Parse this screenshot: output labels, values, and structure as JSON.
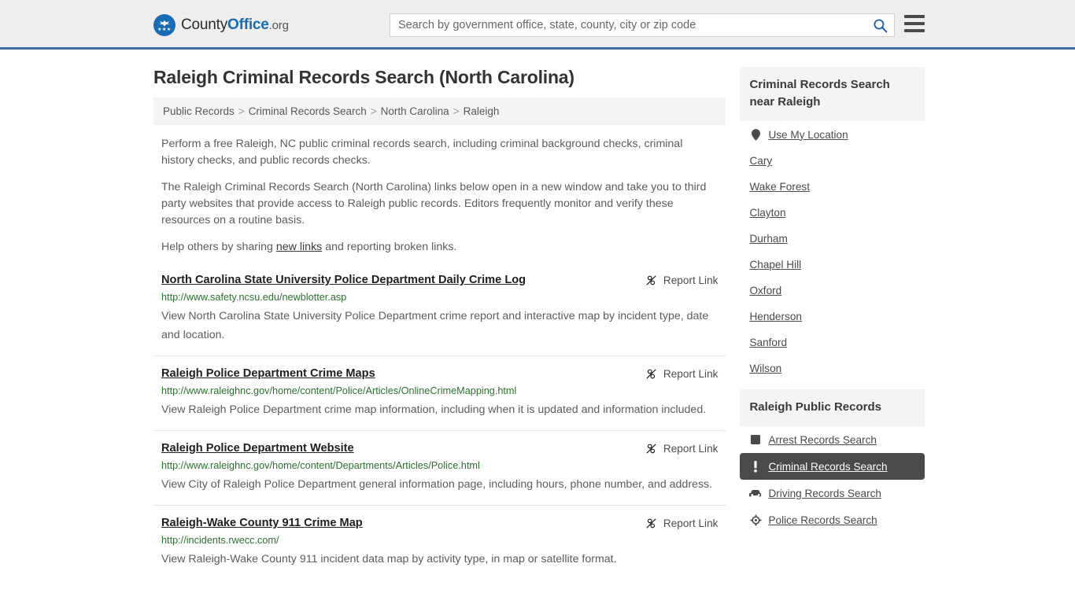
{
  "header": {
    "logo": {
      "name_part1": "County",
      "name_part2": "Office",
      "tld": ".org"
    },
    "search": {
      "placeholder": "Search by government office, state, county, city or zip code",
      "value": ""
    },
    "search_icon": "search-icon",
    "menu_icon": "hamburger-menu-icon",
    "accent_color": "#3a6ea5"
  },
  "main": {
    "title": "Raleigh Criminal Records Search (North Carolina)",
    "breadcrumb": [
      "Public Records",
      "Criminal Records Search",
      "North Carolina",
      "Raleigh"
    ],
    "breadcrumb_separator": ">",
    "intro": {
      "paragraph1": "Perform a free Raleigh, NC public criminal records search, including criminal background checks, criminal history checks, and public records checks.",
      "paragraph2": "The Raleigh Criminal Records Search (North Carolina) links below open in a new window and take you to third party websites that provide access to Raleigh public records. Editors frequently monitor and verify these resources on a routine basis.",
      "paragraph3_before": "Help others by sharing ",
      "paragraph3_link": "new links",
      "paragraph3_after": " and reporting broken links."
    },
    "report_link_label": "Report Link",
    "report_link_icon": "broken-link-icon",
    "results": [
      {
        "title": "North Carolina State University Police Department Daily Crime Log",
        "url": "http://www.safety.ncsu.edu/newblotter.asp",
        "description": "View North Carolina State University Police Department crime report and interactive map by incident type, date and location."
      },
      {
        "title": "Raleigh Police Department Crime Maps",
        "url": "http://www.raleighnc.gov/home/content/Police/Articles/OnlineCrimeMapping.html",
        "description": "View Raleigh Police Department crime map information, including when it is updated and information included."
      },
      {
        "title": "Raleigh Police Department Website",
        "url": "http://www.raleighnc.gov/home/content/Departments/Articles/Police.html",
        "description": "View City of Raleigh Police Department general information page, including hours, phone number, and address."
      },
      {
        "title": "Raleigh-Wake County 911 Crime Map",
        "url": "http://incidents.rwecc.com/",
        "description": "View Raleigh-Wake County 911 incident data map by activity type, in map or satellite format."
      }
    ]
  },
  "sidebar": {
    "nearby": {
      "heading": "Criminal Records Search near Raleigh",
      "use_my_location": {
        "label": "Use My Location",
        "icon": "map-pin-icon"
      },
      "cities": [
        "Cary",
        "Wake Forest",
        "Clayton",
        "Durham",
        "Chapel Hill",
        "Oxford",
        "Henderson",
        "Sanford",
        "Wilson"
      ]
    },
    "public_records": {
      "heading": "Raleigh Public Records",
      "items": [
        {
          "label": "Arrest Records Search",
          "icon": "handcuffs-icon",
          "active": false
        },
        {
          "label": "Criminal Records Search",
          "icon": "exclamation-icon",
          "active": true
        },
        {
          "label": "Driving Records Search",
          "icon": "car-icon",
          "active": false
        },
        {
          "label": "Police Records Search",
          "icon": "police-badge-icon",
          "active": false
        }
      ]
    }
  },
  "colors": {
    "header_bg": "#eeeeec",
    "header_border": "#3a6ea5",
    "link_green": "#2e7031",
    "active_bg": "#4a4a4a",
    "panel_bg": "#f4f4f2"
  }
}
